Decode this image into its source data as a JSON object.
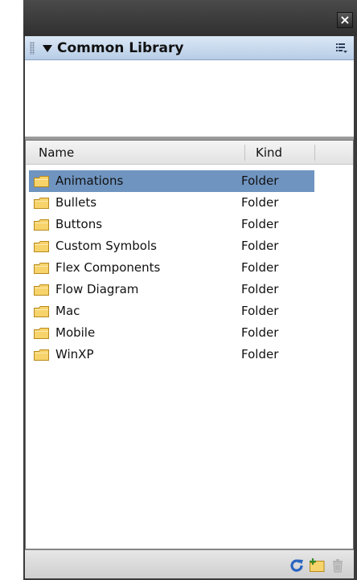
{
  "window": {
    "close_glyph": "×"
  },
  "panel": {
    "title": "Common Library",
    "collapse_icon": "triangle-down-icon",
    "menu_icon": "panel-menu-icon"
  },
  "columns": {
    "name": "Name",
    "kind": "Kind"
  },
  "items": [
    {
      "name": "Animations",
      "kind": "Folder",
      "selected": true
    },
    {
      "name": "Bullets",
      "kind": "Folder",
      "selected": false
    },
    {
      "name": "Buttons",
      "kind": "Folder",
      "selected": false
    },
    {
      "name": "Custom Symbols",
      "kind": "Folder",
      "selected": false
    },
    {
      "name": "Flex Components",
      "kind": "Folder",
      "selected": false
    },
    {
      "name": "Flow Diagram",
      "kind": "Folder",
      "selected": false
    },
    {
      "name": "Mac",
      "kind": "Folder",
      "selected": false
    },
    {
      "name": "Mobile",
      "kind": "Folder",
      "selected": false
    },
    {
      "name": "WinXP",
      "kind": "Folder",
      "selected": false
    }
  ],
  "footer": {
    "buttons": [
      "refresh-icon",
      "new-folder-icon",
      "trash-icon"
    ]
  },
  "colors": {
    "selection": "#6f94c0",
    "header_gradient_top": "#dbe7f5",
    "header_gradient_bottom": "#b7cde6",
    "panel_dark": "#3a3a3a",
    "folder": "#f7d36b",
    "refresh": "#2a64c0"
  }
}
